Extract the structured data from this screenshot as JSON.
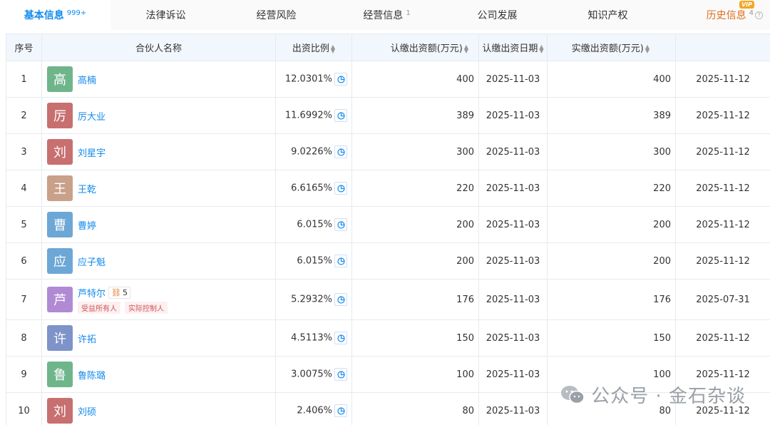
{
  "tabs": [
    {
      "label": "基本信息",
      "count": "999+",
      "active": true
    },
    {
      "label": "法律诉讼",
      "count": ""
    },
    {
      "label": "经营风险",
      "count": ""
    },
    {
      "label": "经营信息",
      "count": "1"
    },
    {
      "label": "公司发展",
      "count": ""
    },
    {
      "label": "知识产权",
      "count": ""
    },
    {
      "label": "历史信息",
      "count": "4",
      "badge": "VIP"
    }
  ],
  "table": {
    "headers": {
      "no": "序号",
      "name": "合伙人名称",
      "ratio": "出资比例",
      "subscribed": "认缴出资额(万元)",
      "subscribed_date": "认缴出资日期",
      "paid": "实缴出资额(万元)"
    },
    "rows": [
      {
        "no": "1",
        "avatar": "高",
        "avatar_color": "#6fb58c",
        "name": "高楠",
        "ratio": "12.0301%",
        "subscribed": "400",
        "subscribed_date": "2025-11-03",
        "paid": "400",
        "paid_date": "2025-11-12"
      },
      {
        "no": "2",
        "avatar": "厉",
        "avatar_color": "#c86f6f",
        "name": "厉大业",
        "ratio": "11.6992%",
        "subscribed": "389",
        "subscribed_date": "2025-11-03",
        "paid": "389",
        "paid_date": "2025-11-12"
      },
      {
        "no": "3",
        "avatar": "刘",
        "avatar_color": "#c86f6f",
        "name": "刘星宇",
        "ratio": "9.0226%",
        "subscribed": "300",
        "subscribed_date": "2025-11-03",
        "paid": "300",
        "paid_date": "2025-11-12"
      },
      {
        "no": "4",
        "avatar": "王",
        "avatar_color": "#c9a08a",
        "name": "王乾",
        "ratio": "6.6165%",
        "subscribed": "220",
        "subscribed_date": "2025-11-03",
        "paid": "220",
        "paid_date": "2025-11-12"
      },
      {
        "no": "5",
        "avatar": "曹",
        "avatar_color": "#6da7d6",
        "name": "曹婷",
        "ratio": "6.015%",
        "subscribed": "200",
        "subscribed_date": "2025-11-03",
        "paid": "200",
        "paid_date": "2025-11-12"
      },
      {
        "no": "6",
        "avatar": "应",
        "avatar_color": "#6da7d6",
        "name": "应子魁",
        "ratio": "6.015%",
        "subscribed": "200",
        "subscribed_date": "2025-11-03",
        "paid": "200",
        "paid_date": "2025-11-12"
      },
      {
        "no": "7",
        "avatar": "芦",
        "avatar_color": "#b08bd4",
        "name": "芦特尔",
        "link_count": "5",
        "tags": [
          "受益所有人",
          "实际控制人"
        ],
        "ratio": "5.2932%",
        "subscribed": "176",
        "subscribed_date": "2025-11-03",
        "paid": "176",
        "paid_date": "2025-07-31"
      },
      {
        "no": "8",
        "avatar": "许",
        "avatar_color": "#7d93c9",
        "name": "许拓",
        "ratio": "4.5113%",
        "subscribed": "150",
        "subscribed_date": "2025-11-03",
        "paid": "150",
        "paid_date": "2025-11-12"
      },
      {
        "no": "9",
        "avatar": "鲁",
        "avatar_color": "#6fb58c",
        "name": "鲁陈璐",
        "ratio": "3.0075%",
        "subscribed": "100",
        "subscribed_date": "2025-11-03",
        "paid": "100",
        "paid_date": "2025-11-12"
      },
      {
        "no": "10",
        "avatar": "刘",
        "avatar_color": "#c86f6f",
        "name": "刘硕",
        "ratio": "2.406%",
        "subscribed": "80",
        "subscribed_date": "2025-11-03",
        "paid": "80",
        "paid_date": "2025-11-12"
      }
    ]
  },
  "watermark": {
    "text": "公众号 · 金石杂谈"
  },
  "colors": {
    "accent": "#128bed",
    "history": "#e06e1e",
    "header_bg": "#f2f7fd",
    "border": "#e6eaf0"
  }
}
